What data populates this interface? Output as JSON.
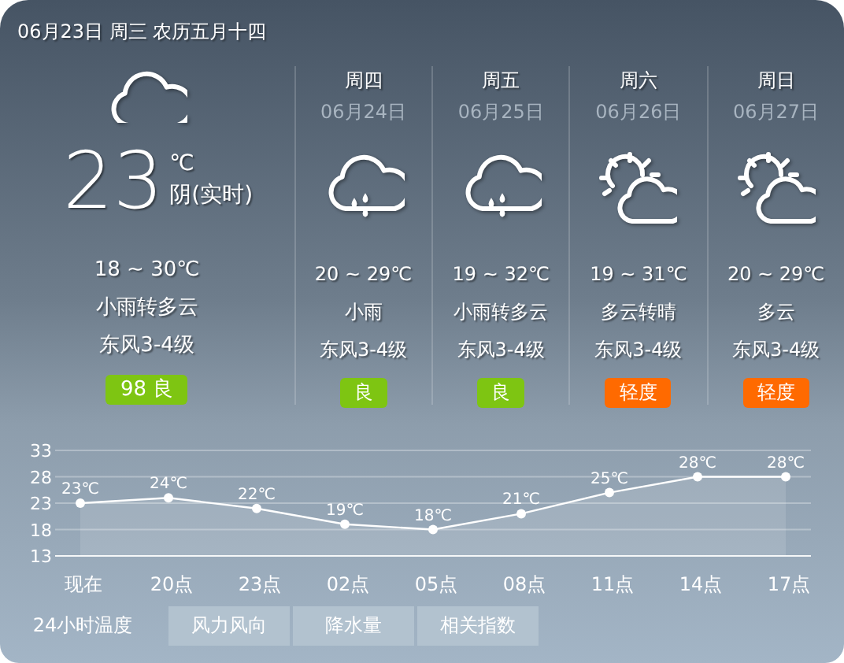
{
  "header": {
    "date": "06月23日 周三 农历五月十四"
  },
  "today": {
    "kind": "cloudy",
    "temp": "23",
    "unit": "℃",
    "condition": "阴(实时)",
    "range": "18 ~ 30℃",
    "weather": "小雨转多云",
    "wind": "东风3-4级",
    "aqi": {
      "label": "98 良",
      "color": "#7ec512"
    }
  },
  "forecast": [
    {
      "weekday": "周四",
      "date": "06月24日",
      "kind": "rain",
      "range": "20 ~ 29℃",
      "weather": "小雨",
      "wind": "东风3-4级",
      "aqi": {
        "label": "良",
        "color": "#7ec512"
      }
    },
    {
      "weekday": "周五",
      "date": "06月25日",
      "kind": "rain",
      "range": "19 ~ 32℃",
      "weather": "小雨转多云",
      "wind": "东风3-4级",
      "aqi": {
        "label": "良",
        "color": "#7ec512"
      }
    },
    {
      "weekday": "周六",
      "date": "06月26日",
      "kind": "partly-cloudy",
      "range": "19 ~ 31℃",
      "weather": "多云转晴",
      "wind": "东风3-4级",
      "aqi": {
        "label": "轻度",
        "color": "#ff6a00"
      }
    },
    {
      "weekday": "周日",
      "date": "06月27日",
      "kind": "partly-cloudy",
      "range": "20 ~ 29℃",
      "weather": "多云",
      "wind": "东风3-4级",
      "aqi": {
        "label": "轻度",
        "color": "#ff6a00"
      }
    }
  ],
  "hourly": {
    "chart_data": {
      "type": "area",
      "categories": [
        "现在",
        "20点",
        "23点",
        "02点",
        "05点",
        "08点",
        "11点",
        "14点",
        "17点"
      ],
      "series": [
        {
          "color": "#ffffff",
          "values": [
            23,
            24,
            22,
            19,
            18,
            21,
            25,
            28,
            28
          ]
        }
      ],
      "ylim": [
        13,
        33
      ],
      "yticks": [
        13,
        18,
        23,
        28,
        33
      ],
      "grid": true,
      "value_labels": [
        "23℃",
        "24℃",
        "22℃",
        "19℃",
        "18℃",
        "21℃",
        "25℃",
        "28℃",
        "28℃"
      ]
    }
  },
  "tabs": [
    {
      "label": "24小时温度",
      "selected": true
    },
    {
      "label": "风力风向",
      "selected": false
    },
    {
      "label": "降水量",
      "selected": false
    },
    {
      "label": "相关指数",
      "selected": false
    }
  ]
}
